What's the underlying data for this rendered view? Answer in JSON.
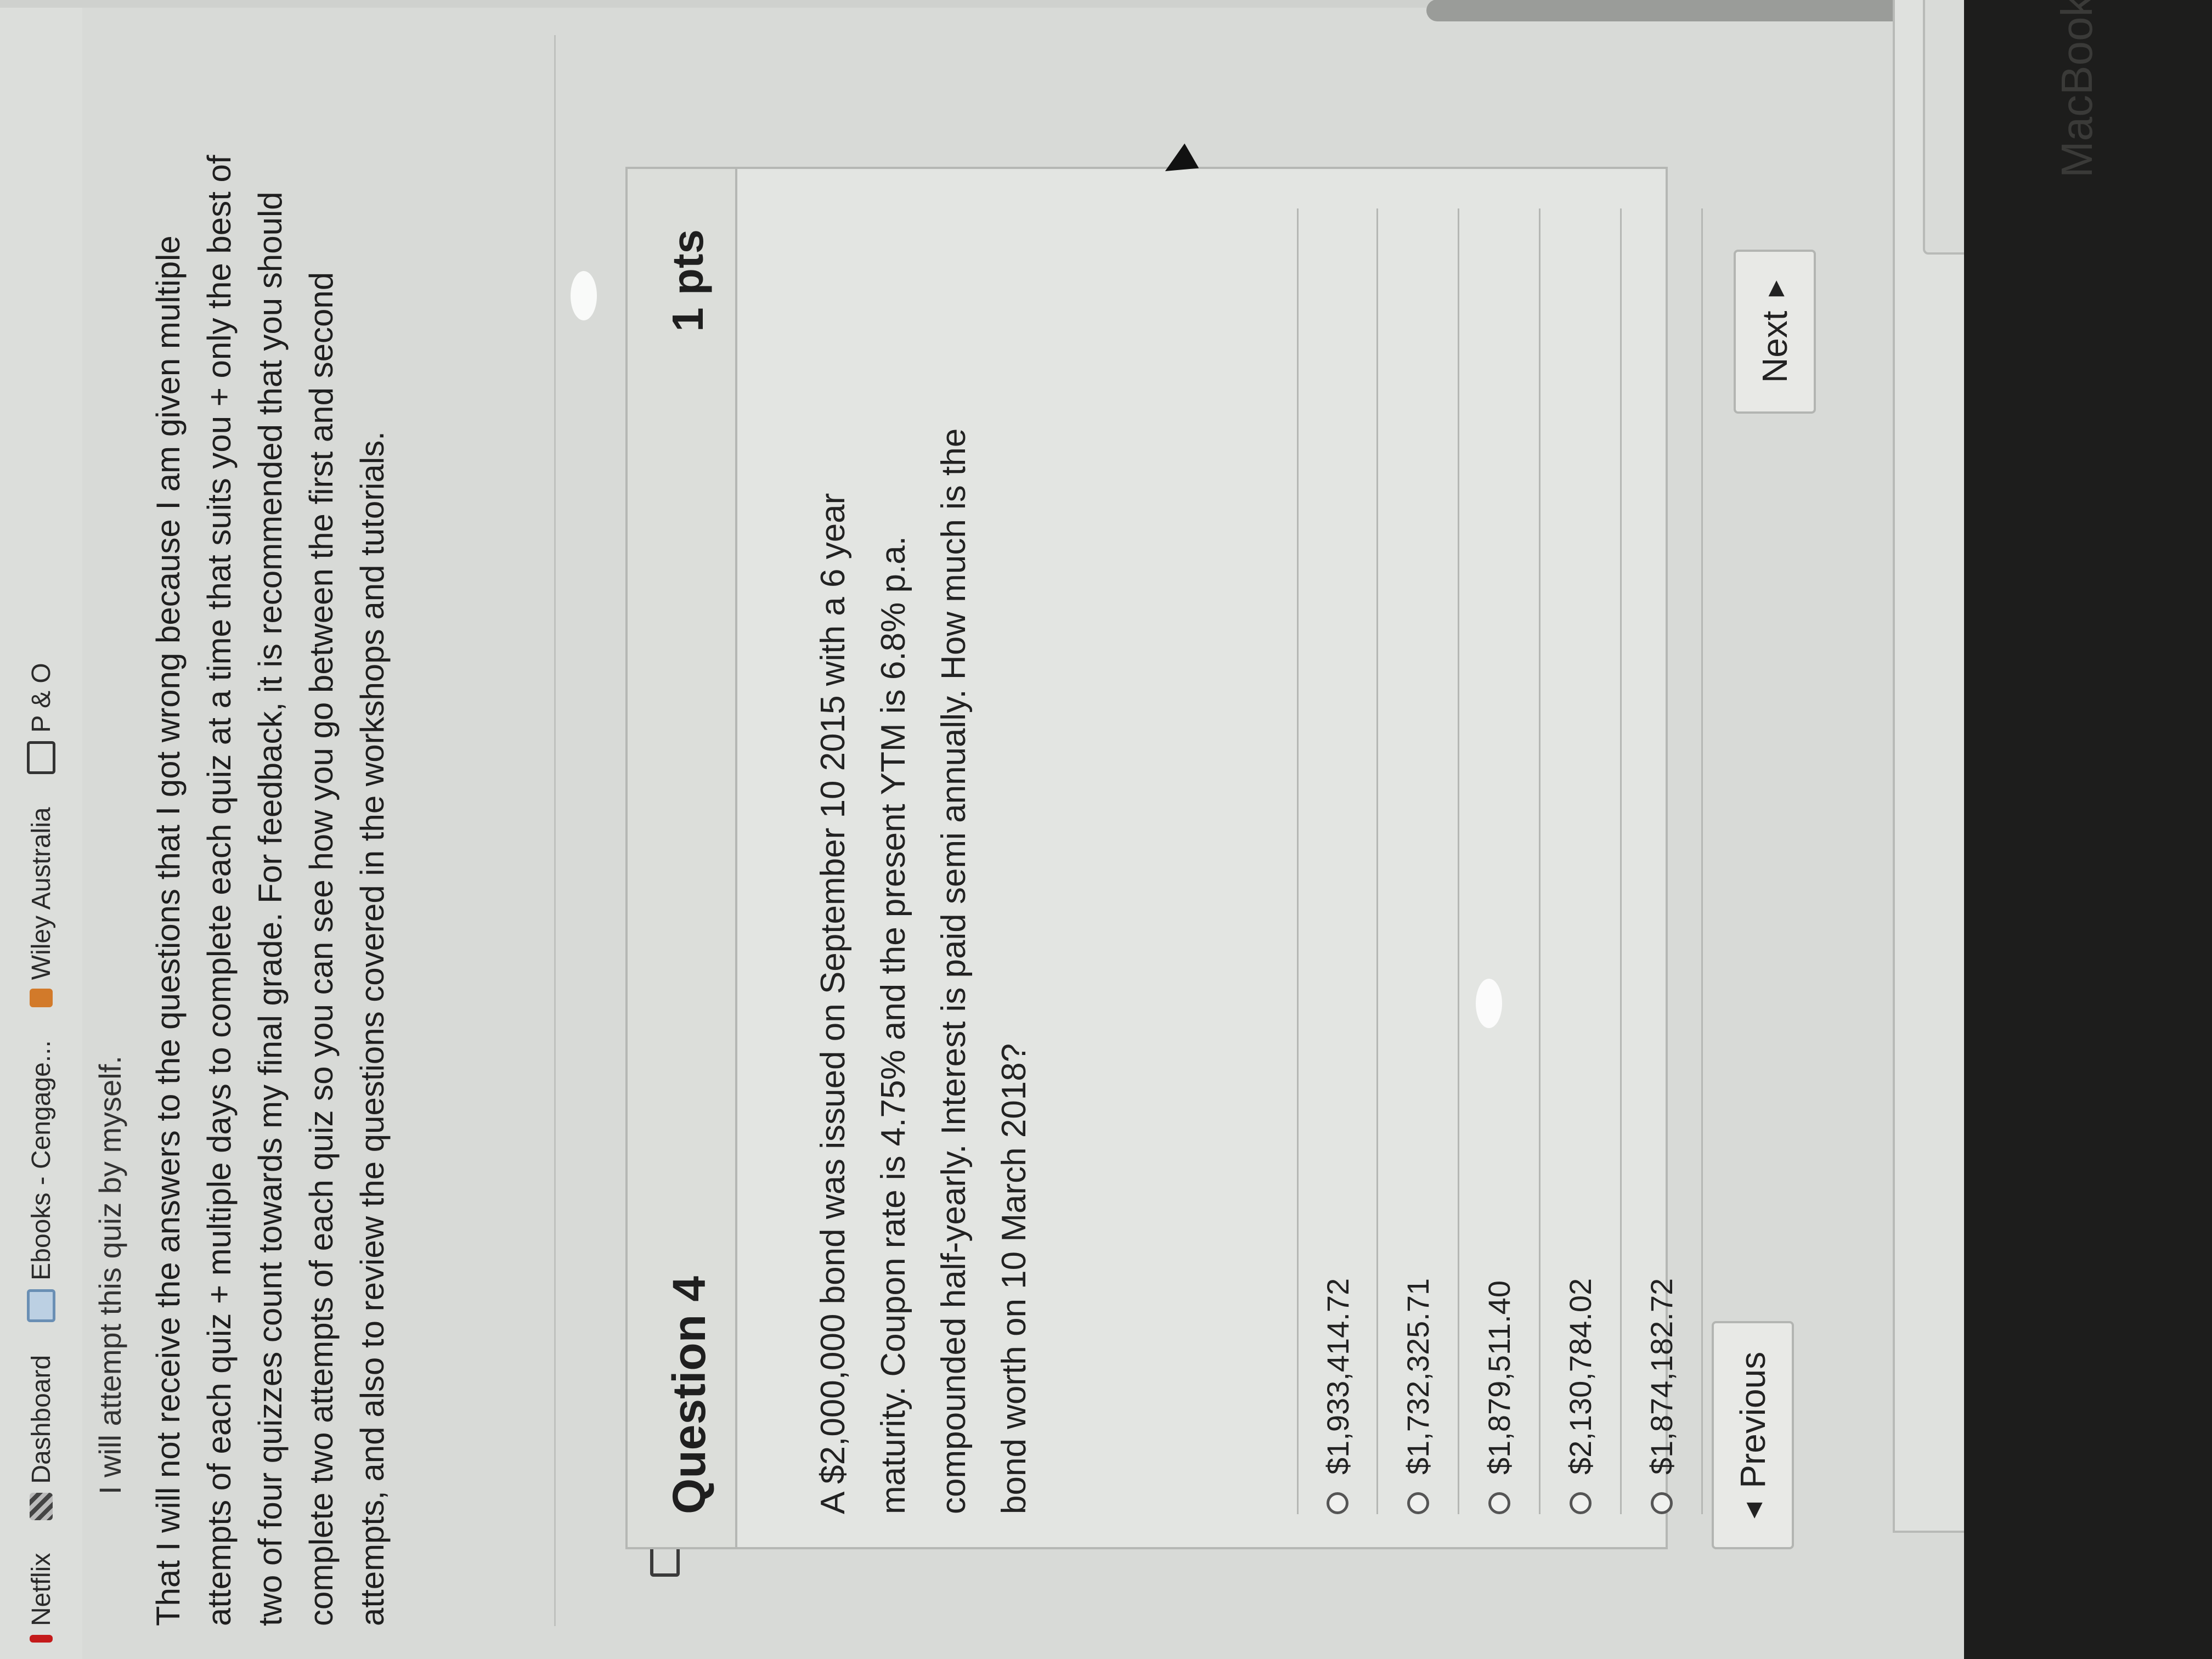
{
  "bookmarks": [
    {
      "label": "Netflix",
      "icon": "netflix-icon"
    },
    {
      "label": "Dashboard",
      "icon": "dashboard-icon"
    },
    {
      "label": "Ebooks - Cengage...",
      "icon": "ebook-icon"
    },
    {
      "label": "Wiley Australia",
      "icon": "wiley-icon"
    },
    {
      "label": "P & O",
      "icon": "folder-icon"
    }
  ],
  "intro": {
    "cut_line": "I will attempt this quiz by myself.",
    "paragraph": "That I will not receive the answers to the questions that I got wrong because I am given multiple attempts of each quiz + multiple days to complete each quiz at a time that suits you + only the best of two of four quizzes count towards my final grade. For feedback, it is recommended that you should complete two attempts of each quiz so you can see how you go between the first and second attempts, and also to review the questions covered in the workshops and tutorials."
  },
  "question": {
    "title": "Question 4",
    "points": "1 pts",
    "text": "A $2,000,000 bond was issued on September 10 2015 with a 6 year maturity. Coupon rate is 4.75% and the present YTM is 6.8% p.a. compounded half-yearly. Interest is paid semi annually. How much is the bond worth on 10 March 2018?",
    "options": [
      "$1,933,414.72",
      "$1,732,325.71",
      "$1,879,511.40",
      "$2,130,784.02",
      "$1,874,182.72"
    ]
  },
  "nav": {
    "previous": "Previous",
    "next": "Next"
  },
  "device": {
    "brand": "MacBook"
  }
}
